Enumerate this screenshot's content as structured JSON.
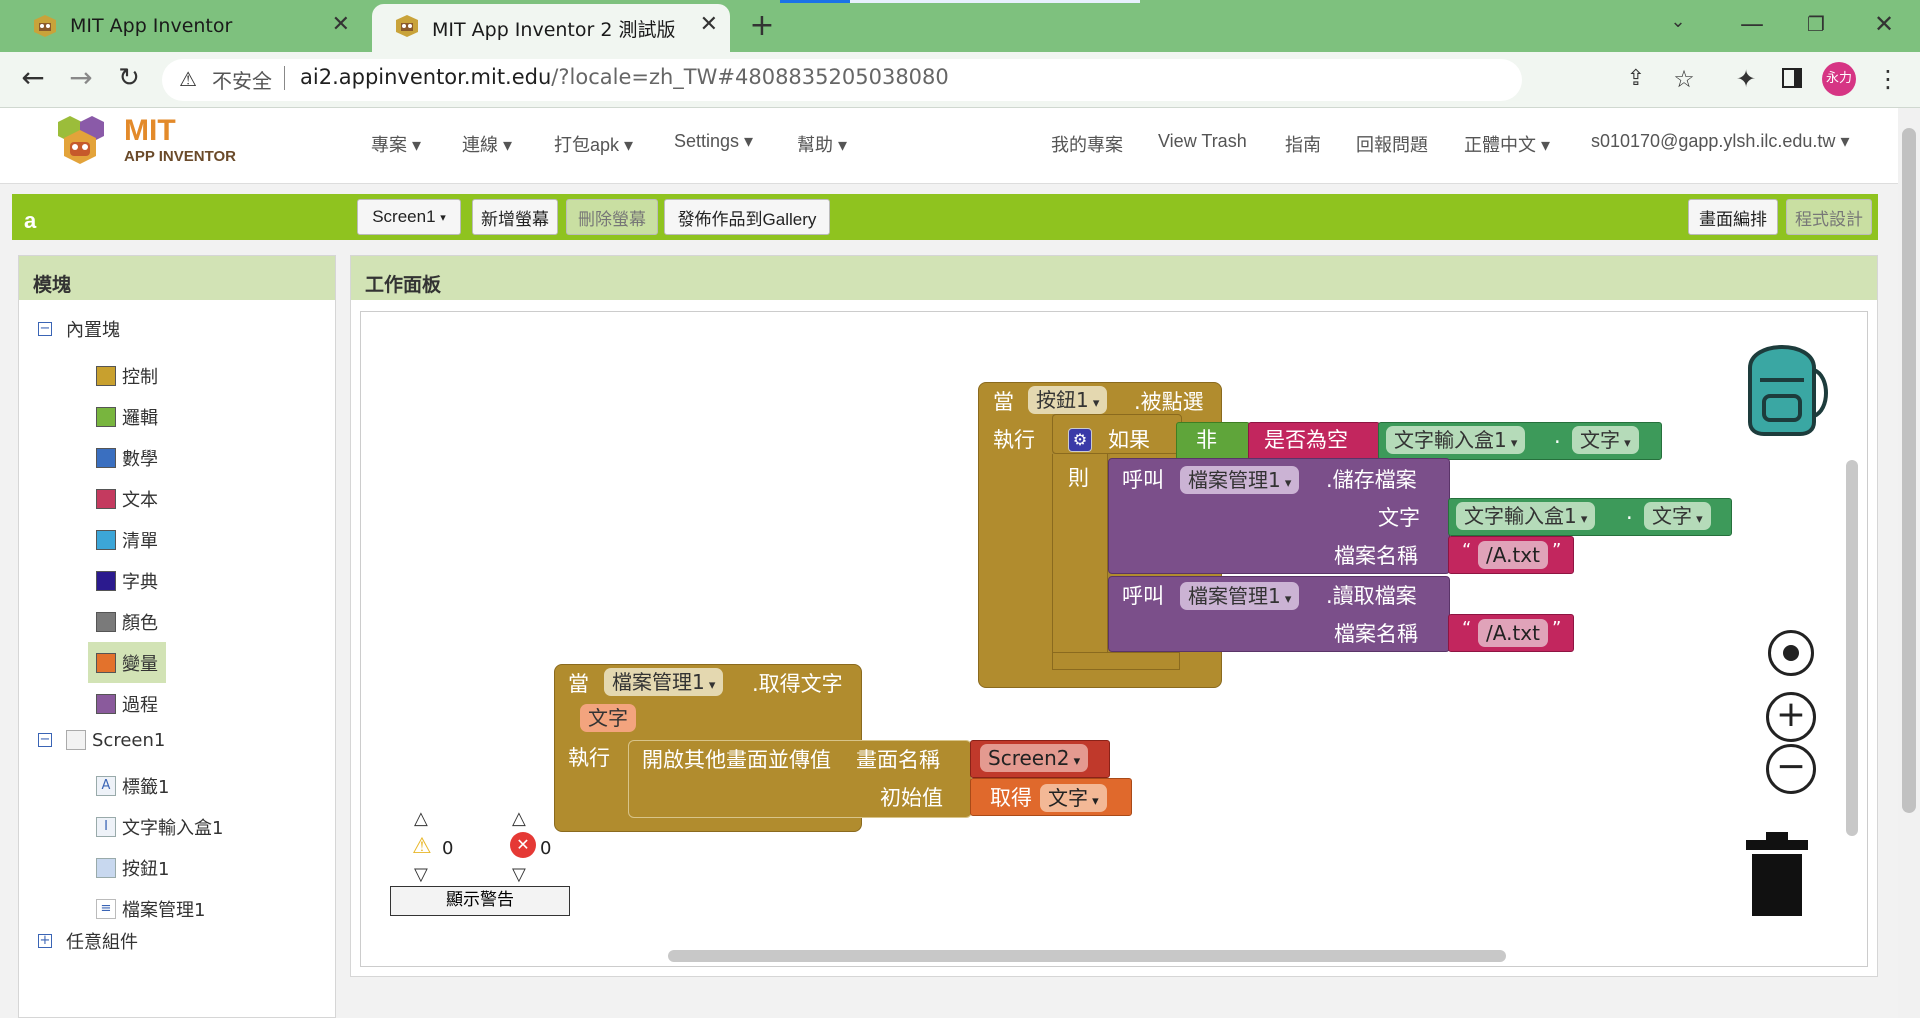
{
  "browser": {
    "tabs": [
      {
        "title": "MIT App Inventor"
      },
      {
        "title": "MIT App Inventor 2 測試版"
      }
    ],
    "security": "不安全",
    "url_host": "ai2.appinventor.mit.edu",
    "url_rest": "/?locale=zh_TW#4808835205038080",
    "profile": "永力"
  },
  "app": {
    "logo_mit": "MIT",
    "logo_sub": "APP INVENTOR",
    "menu": [
      "專案",
      "連線",
      "打包apk",
      "Settings",
      "幫助"
    ],
    "right_links": [
      "我的專案",
      "View Trash",
      "指南",
      "回報問題",
      "正體中文",
      "s010170@gapp.ylsh.ilc.edu.tw"
    ],
    "project_name": "a",
    "screen_select": "Screen1",
    "add_screen": "新增螢幕",
    "remove_screen": "刪除螢幕",
    "publish": "發佈作品到Gallery",
    "designer": "畫面編排",
    "blocks_editor": "程式設計"
  },
  "blocks_panel": {
    "title": "模塊",
    "builtin": "內置塊",
    "builtin_items": [
      {
        "label": "控制",
        "color": "#c8a02e"
      },
      {
        "label": "邏輯",
        "color": "#78b53e"
      },
      {
        "label": "數學",
        "color": "#3a6fc0"
      },
      {
        "label": "文本",
        "color": "#c43a5f"
      },
      {
        "label": "清單",
        "color": "#3ca6d8"
      },
      {
        "label": "字典",
        "color": "#2b1a8e"
      },
      {
        "label": "顏色",
        "color": "#7a7a7a"
      },
      {
        "label": "變量",
        "color": "#e3722c"
      },
      {
        "label": "過程",
        "color": "#8a5a9c"
      }
    ],
    "screen": "Screen1",
    "components": [
      "標籤1",
      "文字輸入盒1",
      "按鈕1",
      "檔案管理1"
    ],
    "any_component": "任意組件"
  },
  "workspace": {
    "title": "工作面板",
    "warnings": "0",
    "errors": "0",
    "show_warnings": "顯示警告",
    "block1": {
      "when": "當",
      "component": "按鈕1",
      "event": ".被點選",
      "do": "執行",
      "if": "如果",
      "not": "非",
      "is_empty": "是否為空",
      "textbox": "文字輸入盒1",
      "dot": ".",
      "text_prop": "文字",
      "then": "則",
      "call": "呼叫",
      "file_comp": "檔案管理1",
      "save_method": ".儲存檔案",
      "text_arg": "文字",
      "filename_arg": "檔案名稱",
      "filename1": "/A.txt",
      "read_method": ".讀取檔案",
      "filename2": "/A.txt",
      "quote_open": "“",
      "quote_close": "”"
    },
    "block2": {
      "when": "當",
      "component": "檔案管理1",
      "event": ".取得文字",
      "param": "文字",
      "do": "執行",
      "open_screen": "開啟其他畫面並傳值",
      "screen_name_arg": "畫面名稱",
      "screen_value": "Screen2",
      "start_value_arg": "初始值",
      "get": "取得",
      "get_var": "文字"
    }
  }
}
